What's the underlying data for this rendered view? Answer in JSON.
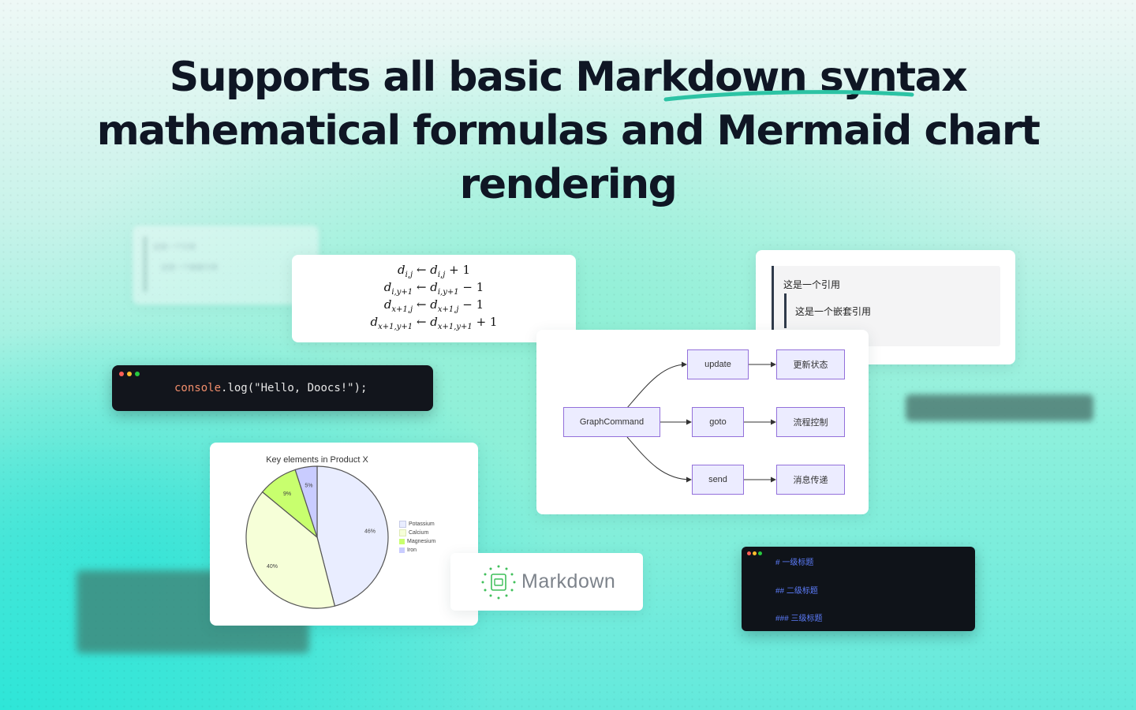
{
  "headline": {
    "line1": "Supports all basic Markdown syntax",
    "line2": "mathematical formulas and  Mermaid chart",
    "line3": "rendering",
    "accent_color": "#2cc3a4"
  },
  "ghost_quote": {
    "line1": "这是一个引用",
    "line2": "这是一个嵌套引用"
  },
  "math": {
    "rows": [
      {
        "lhs": "d",
        "lhs_sub": "i,j",
        "rhs": "d",
        "rhs_sub": "i,j",
        "op": "+ 1"
      },
      {
        "lhs": "d",
        "lhs_sub": "i,y+1",
        "rhs": "d",
        "rhs_sub": "i,y+1",
        "op": "− 1"
      },
      {
        "lhs": "d",
        "lhs_sub": "x+1,j",
        "rhs": "d",
        "rhs_sub": "x+1,j",
        "op": "− 1"
      },
      {
        "lhs": "d",
        "lhs_sub": "x+1,y+1",
        "rhs": "d",
        "rhs_sub": "x+1,y+1",
        "op": "+ 1"
      }
    ],
    "arrow": "←"
  },
  "code": {
    "obj": "console",
    "dot_fn": ".log(",
    "str": "\"Hello, Doocs!\"",
    "tail": ");",
    "dot_colors": [
      "#ff5f56",
      "#ffbd2e",
      "#27c93f"
    ]
  },
  "quote": {
    "outer": "这是一个引用",
    "inner": "这是一个嵌套引用"
  },
  "flow": {
    "root": "GraphCommand",
    "branches": [
      "update",
      "goto",
      "send"
    ],
    "targets": [
      "更新状态",
      "流程控制",
      "消息传递"
    ]
  },
  "chart_data": {
    "type": "pie",
    "title": "Key elements in Product X",
    "labels": [
      "Potassium",
      "Calcium",
      "Magnesium",
      "Iron"
    ],
    "values": [
      46,
      40,
      9,
      5
    ],
    "value_labels": [
      "46%",
      "40%",
      "9%",
      "5%"
    ],
    "colors": [
      "#e9edff",
      "#f6ffd8",
      "#c8ff6e",
      "#c9ccff"
    ]
  },
  "markdown_badge": {
    "label": "Markdown"
  },
  "md_code": {
    "h1": "# 一级标题",
    "h2": "## 二级标题",
    "h3": "### 三级标题"
  }
}
